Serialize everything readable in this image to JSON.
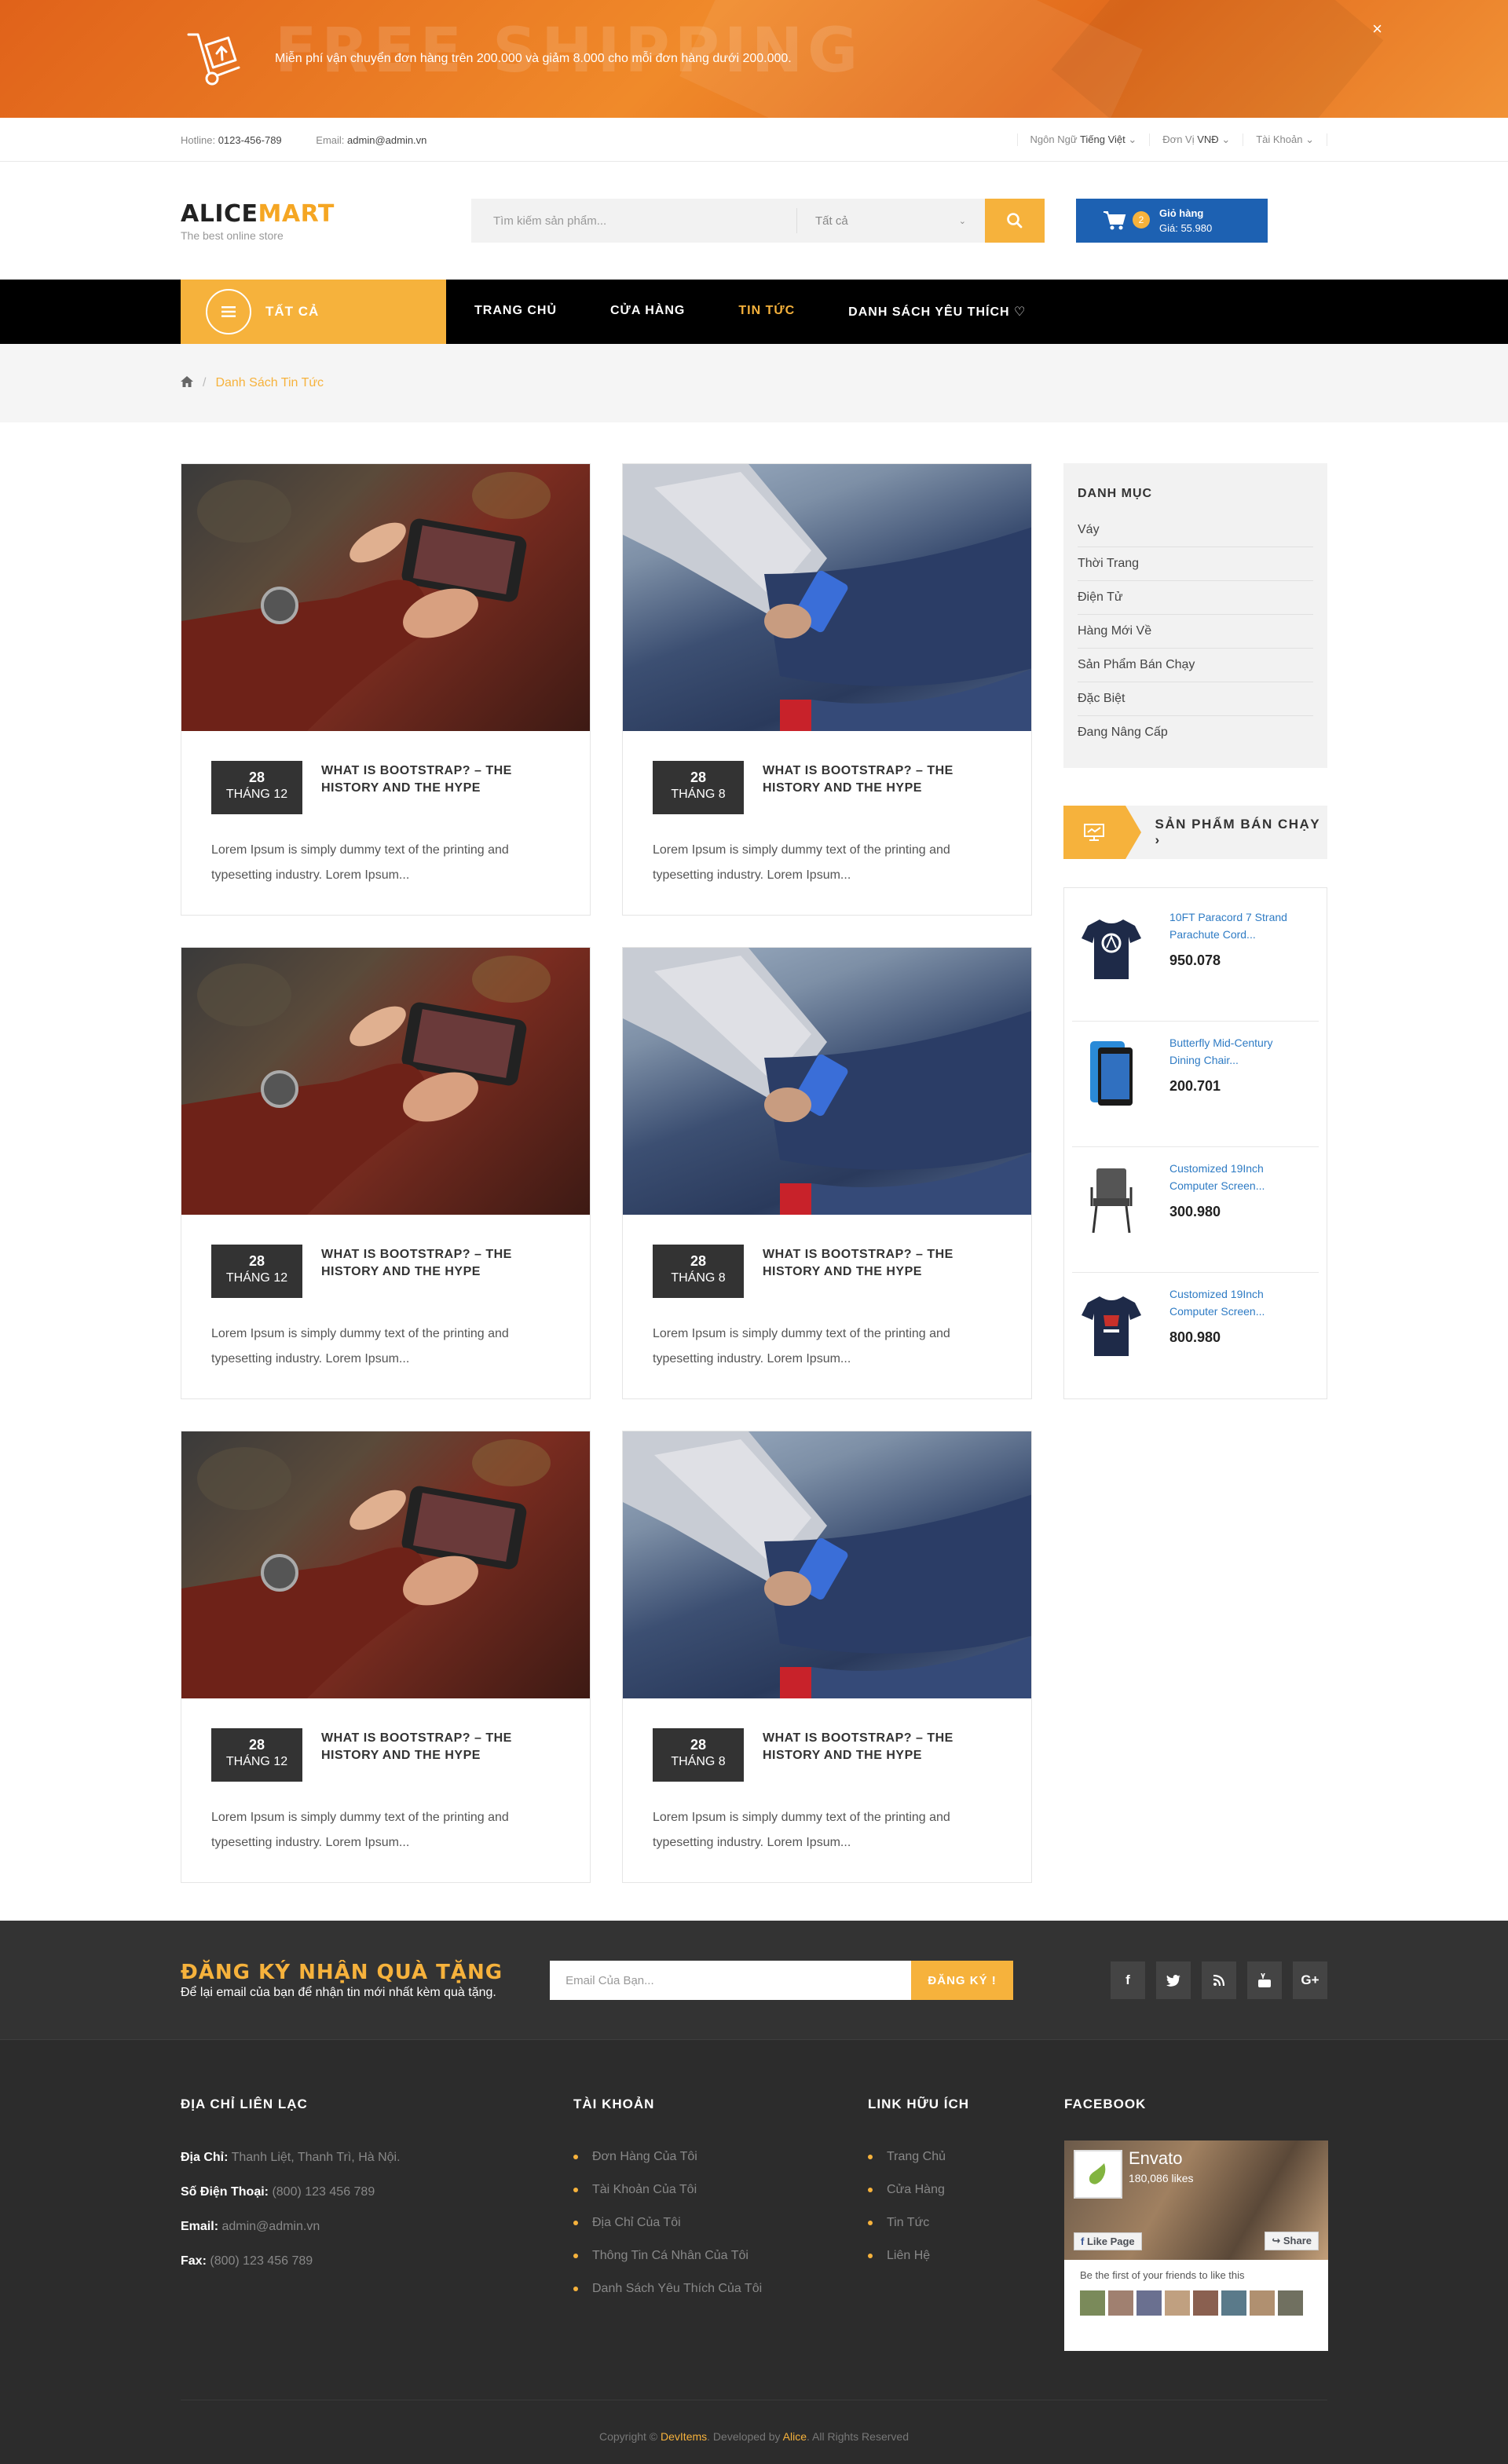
{
  "promo": {
    "big_text": "FREE SHIPPING",
    "text": "Miễn phí vận chuyển đơn hàng trên 200.000 và giảm 8.000 cho mỗi đơn hàng dưới 200.000.",
    "close": "×"
  },
  "topbar": {
    "hotline_label": "Hotline:",
    "hotline": "0123-456-789",
    "email_label": "Email:",
    "email": "admin@admin.vn",
    "language_label": "Ngôn Ngữ",
    "language": "Tiếng Việt",
    "currency_label": "Đơn Vị",
    "currency": "VNĐ",
    "account": "Tài Khoản"
  },
  "header": {
    "logo_a": "ALICE",
    "logo_b": "MART",
    "tagline": "The best online store",
    "search_placeholder": "Tìm kiếm sản phẩm...",
    "search_category": "Tất cả",
    "cart_count": "2",
    "cart_label": "Giỏ hàng",
    "cart_total": "Giá: 55.980"
  },
  "nav": {
    "all": "TẤT CẢ",
    "items": [
      "TRANG CHỦ",
      "CỬA HÀNG",
      "TIN TỨC",
      "DANH SÁCH YÊU THÍCH ♡"
    ]
  },
  "breadcrumb": {
    "home_icon": "home-icon",
    "current": "Danh Sách Tin Tức"
  },
  "posts": [
    {
      "day": "28",
      "month": "THÁNG 12",
      "title": "WHAT IS BOOTSTRAP? – THE HISTORY AND THE HYPE",
      "excerpt": "Lorem Ipsum is simply dummy text of the printing and typesetting industry. Lorem Ipsum..."
    },
    {
      "day": "28",
      "month": "THÁNG 8",
      "title": "WHAT IS BOOTSTRAP? – THE HISTORY AND THE HYPE",
      "excerpt": "Lorem Ipsum is simply dummy text of the printing and typesetting industry. Lorem Ipsum..."
    },
    {
      "day": "28",
      "month": "THÁNG 12",
      "title": "WHAT IS BOOTSTRAP? – THE HISTORY AND THE HYPE",
      "excerpt": "Lorem Ipsum is simply dummy text of the printing and typesetting industry. Lorem Ipsum..."
    },
    {
      "day": "28",
      "month": "THÁNG 8",
      "title": "WHAT IS BOOTSTRAP? – THE HISTORY AND THE HYPE",
      "excerpt": "Lorem Ipsum is simply dummy text of the printing and typesetting industry. Lorem Ipsum..."
    },
    {
      "day": "28",
      "month": "THÁNG 12",
      "title": "WHAT IS BOOTSTRAP? – THE HISTORY AND THE HYPE",
      "excerpt": "Lorem Ipsum is simply dummy text of the printing and typesetting industry. Lorem Ipsum..."
    },
    {
      "day": "28",
      "month": "THÁNG 8",
      "title": "WHAT IS BOOTSTRAP? – THE HISTORY AND THE HYPE",
      "excerpt": "Lorem Ipsum is simply dummy text of the printing and typesetting industry. Lorem Ipsum..."
    }
  ],
  "sidebar": {
    "category_title": "DANH MỤC",
    "categories": [
      "Váy",
      "Thời Trang",
      "Điện Tử",
      "Hàng Mới Về",
      "Sản Phẩm Bán Chạy",
      "Đặc Biệt",
      "Đang Nâng Cấp"
    ],
    "best_title": "SẢN PHẨM BÁN CHẠY",
    "products": [
      {
        "name1": "10FT Paracord 7 Strand",
        "name2": "Parachute Cord...",
        "price": "950.078"
      },
      {
        "name1": "Butterfly Mid-Century",
        "name2": "Dining Chair...",
        "price": "200.701"
      },
      {
        "name1": "Customized 19Inch",
        "name2": "Computer Screen...",
        "price": "300.980"
      },
      {
        "name1": "Customized 19Inch",
        "name2": "Computer Screen...",
        "price": "800.980"
      }
    ]
  },
  "newsletter": {
    "title": "ĐĂNG KÝ NHẬN QUÀ TẶNG",
    "subtitle": "Để lại email của bạn để nhận tin mới nhất kèm quà tặng.",
    "placeholder": "Email Của Bạn...",
    "button": "ĐĂNG KÝ !",
    "social": [
      "f",
      "t",
      "rss",
      "yt",
      "G+"
    ]
  },
  "footer": {
    "contact_title": "ĐỊA CHỈ LIÊN LẠC",
    "address_label": "Địa Chỉ:",
    "address": "Thanh Liệt, Thanh Trì, Hà Nội.",
    "phone_label": "Số Điện Thoại:",
    "phone": "(800) 123 456 789",
    "email_label": "Email:",
    "email": "admin@admin.vn",
    "fax_label": "Fax:",
    "fax": "(800) 123 456 789",
    "account_title": "TÀI KHOẢN",
    "account_links": [
      "Đơn Hàng Của Tôi",
      "Tài Khoản Của Tôi",
      "Địa Chỉ Của Tôi",
      "Thông Tin Cá Nhân Của Tôi",
      "Danh Sách Yêu Thích Của Tôi"
    ],
    "links_title": "LINK HỮU ÍCH",
    "useful_links": [
      "Trang Chủ",
      "Cửa Hàng",
      "Tin Tức",
      "Liên Hệ"
    ],
    "facebook_title": "FACEBOOK",
    "fb_name": "Envato",
    "fb_likes": "180,086 likes",
    "fb_like_btn": "Like Page",
    "fb_share_btn": "Share",
    "fb_friends": "Be the first of your friends to like this",
    "copyright_a": "Copyright ©",
    "copyright_b": "DevItems",
    "copyright_c": ". Developed by",
    "copyright_d": "Alice",
    "copyright_e": ". All Rights Reserved"
  },
  "colors": {
    "accent": "#f6b23c",
    "promo": "#e8711f",
    "cart": "#1d61b2",
    "nav": "#000000",
    "footer": "#2c2c2c"
  }
}
